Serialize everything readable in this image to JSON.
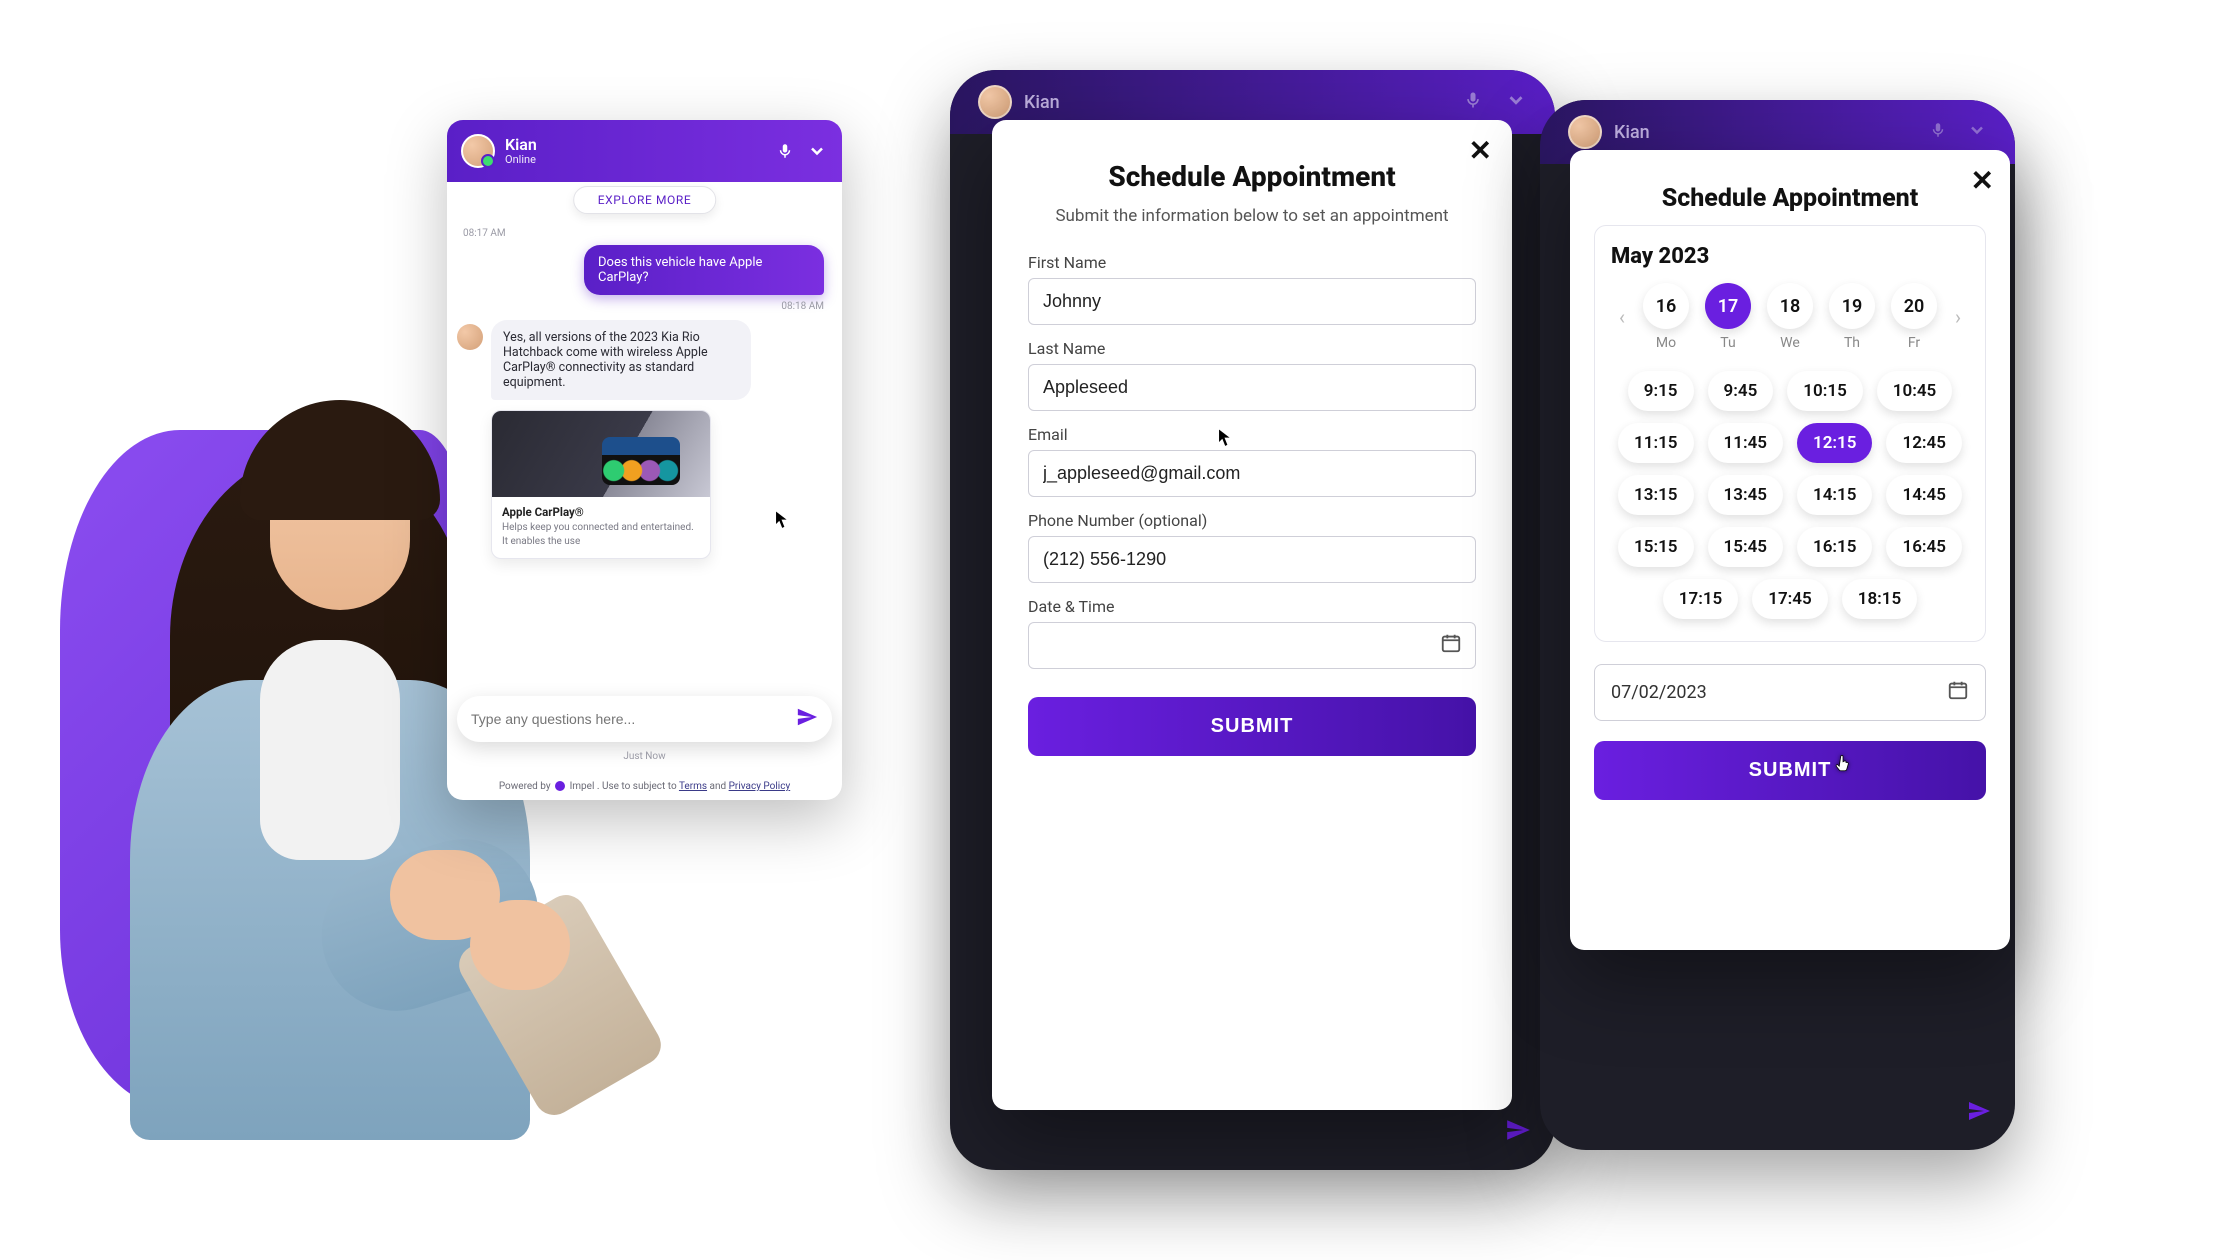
{
  "chat": {
    "agent_name": "Kian",
    "agent_status": "Online",
    "explore_chip": "EXPLORE MORE",
    "ts1": "08:17 AM",
    "user_msg": "Does this vehicle have Apple CarPlay?",
    "ts2": "08:18 AM",
    "bot_msg": "Yes, all versions of the 2023 Kia Rio Hatchback come with wireless Apple CarPlay® connectivity as standard equipment.",
    "card_title": "Apple CarPlay®",
    "card_desc": "Helps keep you connected and entertained. It enables the use",
    "input_placeholder": "Type any questions here...",
    "just_now": "Just Now",
    "footer_prefix": "Powered by ",
    "footer_brand": "Impel",
    "footer_mid": ". Use to subject to ",
    "footer_terms": "Terms",
    "footer_and": " and ",
    "footer_privacy": "Privacy Policy"
  },
  "phone_header": {
    "name": "Kian"
  },
  "form": {
    "title": "Schedule Appointment",
    "subtitle": "Submit the information below to set an appointment",
    "labels": {
      "first": "First Name",
      "last": "Last Name",
      "email": "Email",
      "phone": "Phone Number (optional)",
      "datetime": "Date & Time"
    },
    "values": {
      "first": "Johnny",
      "last": "Appleseed",
      "email": "j_appleseed@gmail.com",
      "phone": "(212) 556-1290",
      "datetime": ""
    },
    "submit": "SUBMIT"
  },
  "calendar": {
    "title": "Schedule Appointment",
    "month": "May 2023",
    "days": [
      {
        "num": "16",
        "dow": "Mo",
        "selected": false
      },
      {
        "num": "17",
        "dow": "Tu",
        "selected": true
      },
      {
        "num": "18",
        "dow": "We",
        "selected": false
      },
      {
        "num": "19",
        "dow": "Th",
        "selected": false
      },
      {
        "num": "20",
        "dow": "Fr",
        "selected": false
      }
    ],
    "times": [
      {
        "t": "9:15",
        "sel": false
      },
      {
        "t": "9:45",
        "sel": false
      },
      {
        "t": "10:15",
        "sel": false
      },
      {
        "t": "10:45",
        "sel": false
      },
      {
        "t": "11:15",
        "sel": false
      },
      {
        "t": "11:45",
        "sel": false
      },
      {
        "t": "12:15",
        "sel": true
      },
      {
        "t": "12:45",
        "sel": false
      },
      {
        "t": "13:15",
        "sel": false
      },
      {
        "t": "13:45",
        "sel": false
      },
      {
        "t": "14:15",
        "sel": false
      },
      {
        "t": "14:45",
        "sel": false
      },
      {
        "t": "15:15",
        "sel": false
      },
      {
        "t": "15:45",
        "sel": false
      },
      {
        "t": "16:15",
        "sel": false
      },
      {
        "t": "16:45",
        "sel": false
      },
      {
        "t": "17:15",
        "sel": false
      },
      {
        "t": "17:45",
        "sel": false
      },
      {
        "t": "18:15",
        "sel": false
      }
    ],
    "date_value": "07/02/2023",
    "submit": "SUBMIT"
  }
}
